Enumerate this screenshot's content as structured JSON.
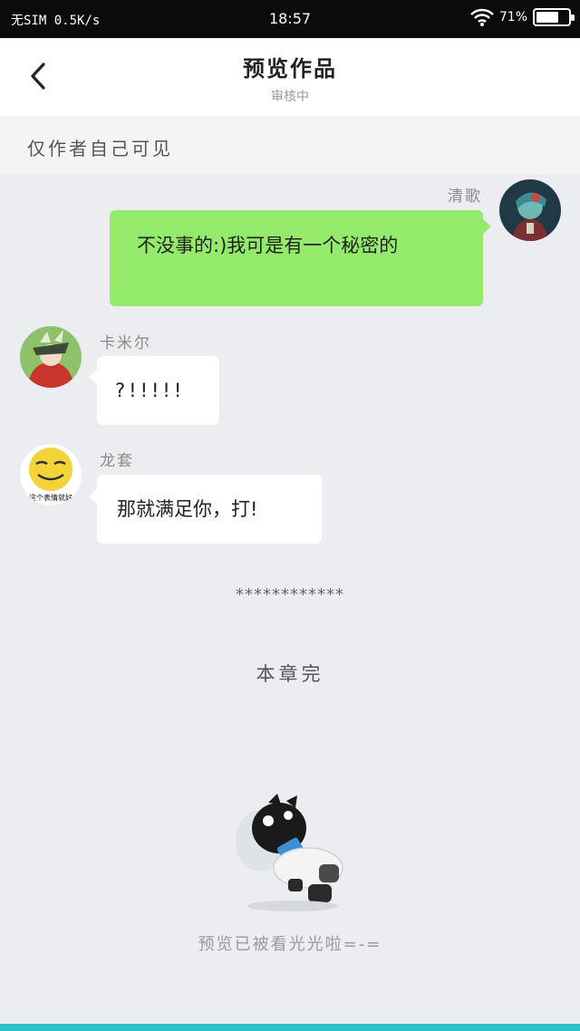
{
  "status_bar": {
    "carrier": "无SIM 0.5K/s",
    "time": "18:57",
    "battery_text": "71%",
    "battery_level": 0.71
  },
  "header": {
    "title": "预览作品",
    "subtitle": "审核中"
  },
  "notice": "仅作者自己可见",
  "messages": [
    {
      "side": "right",
      "name": "清歌",
      "text": "不没事的:)我可是有一个秘密的",
      "bubble_color": "#94eb6b"
    },
    {
      "side": "left",
      "name": "卡米尔",
      "text": "?!!!!!",
      "bubble_color": "#ffffff"
    },
    {
      "side": "left",
      "name": "龙套",
      "text": "那就满足你，打!",
      "bubble_color": "#ffffff",
      "avatar_caption": "这个表情就好"
    }
  ],
  "separator": "************",
  "chapter_end": "本章完",
  "footer_text": "预览已被看光光啦=-=",
  "colors": {
    "accent": "#29c3c8",
    "green_bubble": "#94eb6b",
    "background": "#ebedf0"
  }
}
